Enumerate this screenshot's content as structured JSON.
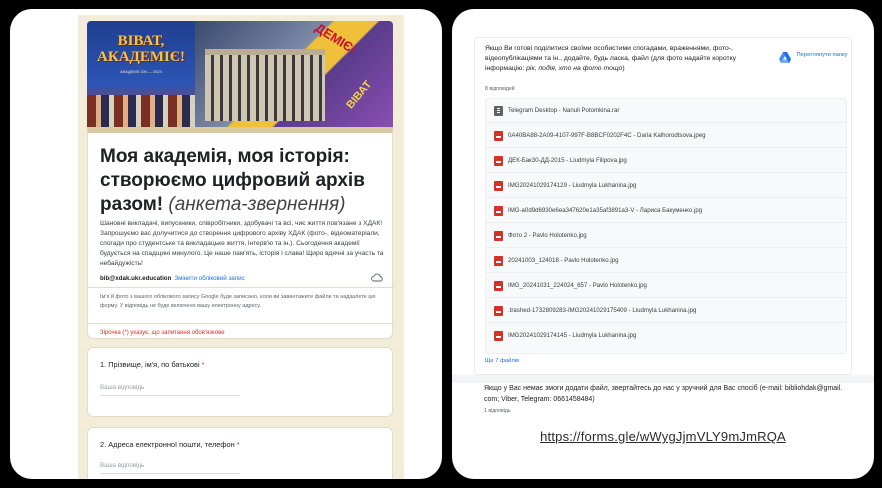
{
  "left": {
    "banner": {
      "title": "ВІВАТ, АКАДЕМІЄ!",
      "subtitle": "АКАДЕМІЇ 105 — 2024",
      "ribbon1": "ДЕМІЄ!",
      "ribbon2": "ВІВАТ"
    },
    "form": {
      "title_main": "Моя академія, моя історія: створюємо цифровий архів разом! ",
      "title_italic": "(анкета-звернення)",
      "description": "Шановні викладачі, випускники, співробітники, здобувачі та всі, чиє життя пов'язане з ХДАК! Запрошуємо вас долучитися до створення цифрового архіву ХДАК (фото-, відеоматеріали, спогади про студентське та викладацьке життя, інтерв'ю та ін.). Сьогодення академії будується на спадщині минулого. Це наше пам'ять, історія і слава! Щиро вдячні за участь та небайдужість!",
      "account_email": "bib@xdak.ukr.education",
      "switch_account": "Змінити обліковий запис",
      "note": "Ім'я й фото з вашого облікового запису Google буде записано, коли ви завантажите файли та надішлете цю форму. У відповідь не буде включено вашу електронну адресу.",
      "required_note": "Зірочка (*) указує, що запитання обов'язкове",
      "questions": [
        {
          "label": "1. Прізвище, ім'я, по батькові",
          "placeholder": "Ваша відповідь"
        },
        {
          "label": "2. Адреса електронної пошти, телефон",
          "placeholder": "Ваша відповідь"
        }
      ],
      "required_star": "*"
    }
  },
  "right": {
    "question": "Якщо Ви готові поділитися своїми особистими спогадами, враженнями, фото-, відеопублікаціями та ін., додайте, будь ласка, файл (для фото надайте коротку інформацію: ",
    "question_italic": "рік, подія, хто на фото тощо",
    "question_end": ")",
    "count": "8 відповідей",
    "drive_link": "Переглянути папку",
    "files": [
      {
        "name": "Telegram Desktop - Nanuli Potomkina.rar",
        "type": "rar"
      },
      {
        "name": "0A40BA88-2A09-4107-997F-B8BCF0202F4C - Daria Kalhorodtsova.jpeg",
        "type": "img"
      },
      {
        "name": "ДЕК-Бак30-ДД-2015 - Liudmyla Filipova.jpg",
        "type": "img"
      },
      {
        "name": "IMG20241029174129 - Liudmyla Lukhanina.jpg",
        "type": "img"
      },
      {
        "name": "IMG-a0d9d6930e6ea347620e1a35af3891a3-V - Лариса Бакуменко.jpg",
        "type": "img"
      },
      {
        "name": "Фото 2 - Pavlo Holotenko.jpg",
        "type": "img"
      },
      {
        "name": "20241003_124018 - Pavlo Holotenko.jpg",
        "type": "img"
      },
      {
        "name": "IMG_20241031_224024_657 - Pavlo Holotenko.jpg",
        "type": "img"
      },
      {
        "name": ".trashed-1732809283-IMG20241029175409 - Liudmyla Lukhanina.jpg",
        "type": "img"
      },
      {
        "name": "IMG20241029174145 - Liudmyla Lukhanina.jpg",
        "type": "img"
      }
    ],
    "more_files": "Ще 7 файлів",
    "question2": "Якщо у Вас немає змоги додати файл, звертайтесь до нас у зручний для Вас спосіб (e-mail: bibliohdak@gmail. com; Viber, Telegram: 0661458484)",
    "count2": "1 відповідь",
    "url": "https://forms.gle/wWygJjmVLY9mJmRQA"
  },
  "colors": {
    "background": "#000000",
    "form_bg": "#f3ecd8",
    "accent_blue": "#1a73e8",
    "required_red": "#d93025",
    "file_icon_red": "#d93025"
  }
}
